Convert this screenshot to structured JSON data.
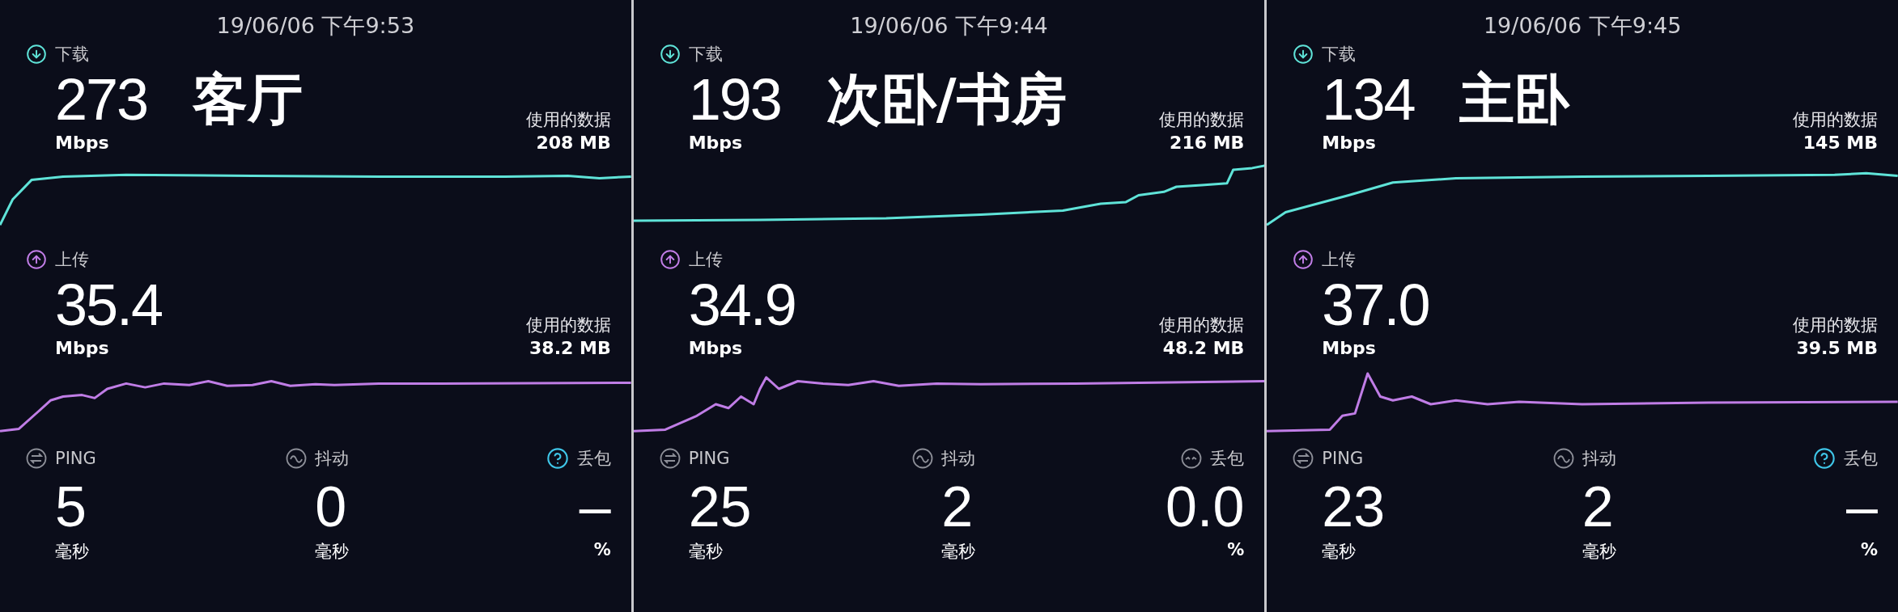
{
  "panels": [
    {
      "timestamp": "19/06/06 下午9:53",
      "room": "客厅",
      "download": {
        "label": "下载",
        "value": "273",
        "unit": "Mbps",
        "data_label": "使用的数据",
        "data_value": "208 MB"
      },
      "upload": {
        "label": "上传",
        "value": "35.4",
        "unit": "Mbps",
        "data_label": "使用的数据",
        "data_value": "38.2 MB"
      },
      "stats": [
        {
          "kind": "ping",
          "label": "PING",
          "value": "5",
          "unit": "毫秒"
        },
        {
          "kind": "jitter",
          "label": "抖动",
          "value": "0",
          "unit": "毫秒"
        },
        {
          "kind": "help",
          "label": "丢包",
          "value": "–",
          "unit": "%"
        }
      ]
    },
    {
      "timestamp": "19/06/06 下午9:44",
      "room": "次卧/书房",
      "download": {
        "label": "下载",
        "value": "193",
        "unit": "Mbps",
        "data_label": "使用的数据",
        "data_value": "216 MB"
      },
      "upload": {
        "label": "上传",
        "value": "34.9",
        "unit": "Mbps",
        "data_label": "使用的数据",
        "data_value": "48.2 MB"
      },
      "stats": [
        {
          "kind": "ping",
          "label": "PING",
          "value": "25",
          "unit": "毫秒"
        },
        {
          "kind": "jitter",
          "label": "抖动",
          "value": "2",
          "unit": "毫秒"
        },
        {
          "kind": "loss",
          "label": "丢包",
          "value": "0.0",
          "unit": "%"
        }
      ]
    },
    {
      "timestamp": "19/06/06 下午9:45",
      "room": "主卧",
      "download": {
        "label": "下载",
        "value": "134",
        "unit": "Mbps",
        "data_label": "使用的数据",
        "data_value": "145 MB"
      },
      "upload": {
        "label": "上传",
        "value": "37.0",
        "unit": "Mbps",
        "data_label": "使用的数据",
        "data_value": "39.5 MB"
      },
      "stats": [
        {
          "kind": "ping",
          "label": "PING",
          "value": "23",
          "unit": "毫秒"
        },
        {
          "kind": "jitter",
          "label": "抖动",
          "value": "2",
          "unit": "毫秒"
        },
        {
          "kind": "help",
          "label": "丢包",
          "value": "–",
          "unit": "%"
        }
      ]
    }
  ]
}
